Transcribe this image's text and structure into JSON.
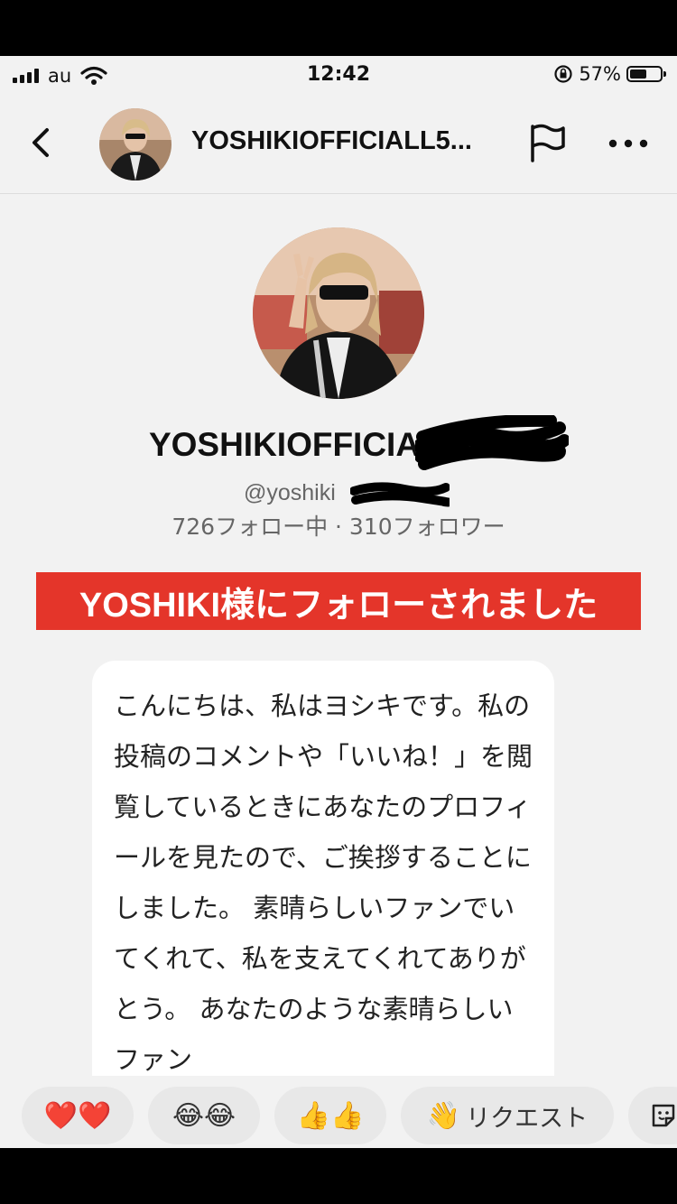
{
  "status_bar": {
    "carrier": "au",
    "time": "12:42",
    "battery_percent": "57%",
    "battery_level": 0.57
  },
  "header": {
    "title": "YOSHIKIOFFICIALL5..."
  },
  "profile": {
    "display_name": "YOSHIKIOFFICIA",
    "handle": "@yoshiki",
    "stats": "726フォロー中 · 310フォロワー"
  },
  "banner": {
    "text": "YOSHIKI様にフォローされました"
  },
  "message": {
    "text": "こんにちは、私はヨシキです。私の投稿のコメントや「いいね！」を閲覧しているときにあなたのプロフィールを見たので、ご挨拶することにしました。 素晴らしいファンでいてくれて、私を支えてくれてありがとう。 あなたのような素晴らしいファン"
  },
  "quick_replies": {
    "hearts": "❤️❤️",
    "laugh": "😂😂",
    "thumbs": "👍👍",
    "request_emoji": "👋",
    "request_label": "リクエスト"
  },
  "icons": {
    "back": "chevron-left-icon",
    "flag": "flag-icon",
    "more": "more-icon",
    "sticker": "sticker-icon",
    "wifi": "wifi-icon",
    "signal": "signal-icon",
    "lock": "rotation-lock-icon",
    "battery": "battery-icon"
  },
  "colors": {
    "banner_bg": "#e4352a",
    "screen_bg": "#f2f2f2"
  }
}
